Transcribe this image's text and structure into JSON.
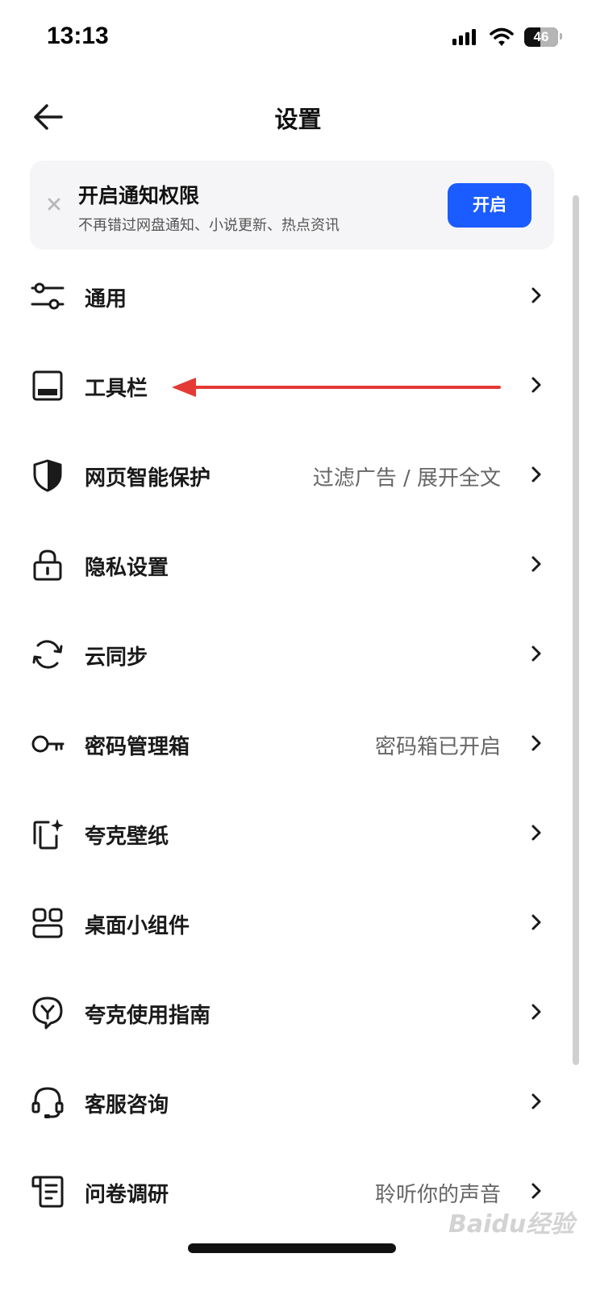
{
  "status_bar": {
    "time": "13:13",
    "battery": "46"
  },
  "header": {
    "title": "设置"
  },
  "notification_card": {
    "title": "开启通知权限",
    "subtitle": "不再错过网盘通知、小说更新、热点资讯",
    "button_label": "开启"
  },
  "menu": {
    "items": [
      {
        "label": "通用",
        "value": "",
        "icon": "sliders-icon"
      },
      {
        "label": "工具栏",
        "value": "",
        "icon": "toolbar-icon"
      },
      {
        "label": "网页智能保护",
        "value": "过滤广告 / 展开全文",
        "icon": "shield-icon"
      },
      {
        "label": "隐私设置",
        "value": "",
        "icon": "lock-icon"
      },
      {
        "label": "云同步",
        "value": "",
        "icon": "sync-icon"
      },
      {
        "label": "密码管理箱",
        "value": "密码箱已开启",
        "icon": "key-icon"
      },
      {
        "label": "夸克壁纸",
        "value": "",
        "icon": "wallpaper-icon"
      },
      {
        "label": "桌面小组件",
        "value": "",
        "icon": "widgets-icon"
      },
      {
        "label": "夸克使用指南",
        "value": "",
        "icon": "guide-icon"
      },
      {
        "label": "客服咨询",
        "value": "",
        "icon": "headset-icon"
      },
      {
        "label": "问卷调研",
        "value": "聆听你的声音",
        "icon": "survey-icon"
      }
    ]
  },
  "watermark": {
    "text": "Baidu经验"
  },
  "colors": {
    "accent": "#1a5cff",
    "annotation": "#e53935"
  }
}
